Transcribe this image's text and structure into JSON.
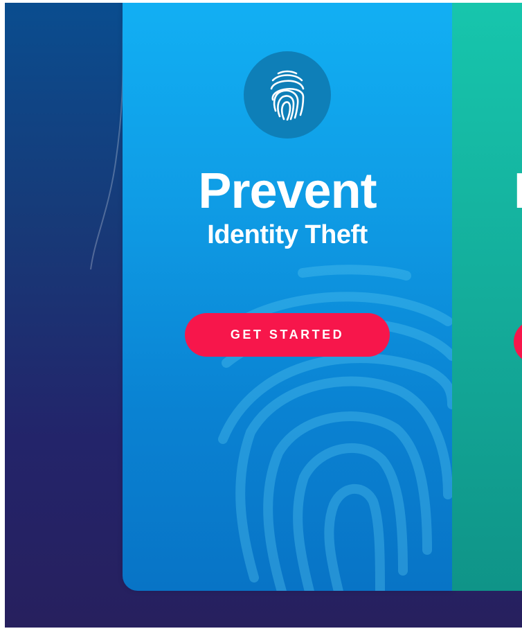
{
  "colors": {
    "background_top": "#0a4d8f",
    "background_bottom": "#27205e",
    "card_top": "#12b0f4",
    "card_bottom": "#0874c6",
    "icon_circle": "#0e7fb8",
    "button": "#f7164b",
    "next_card_top": "#17c6ad",
    "next_card_bottom": "#0f9488"
  },
  "hero_card": {
    "icon": "fingerprint-icon",
    "title": "Prevent",
    "subtitle": "Identity Theft",
    "cta_label": "GET STARTED",
    "background_art": "fingerprint-icon"
  },
  "next_card": {
    "title_fragment": "I"
  }
}
